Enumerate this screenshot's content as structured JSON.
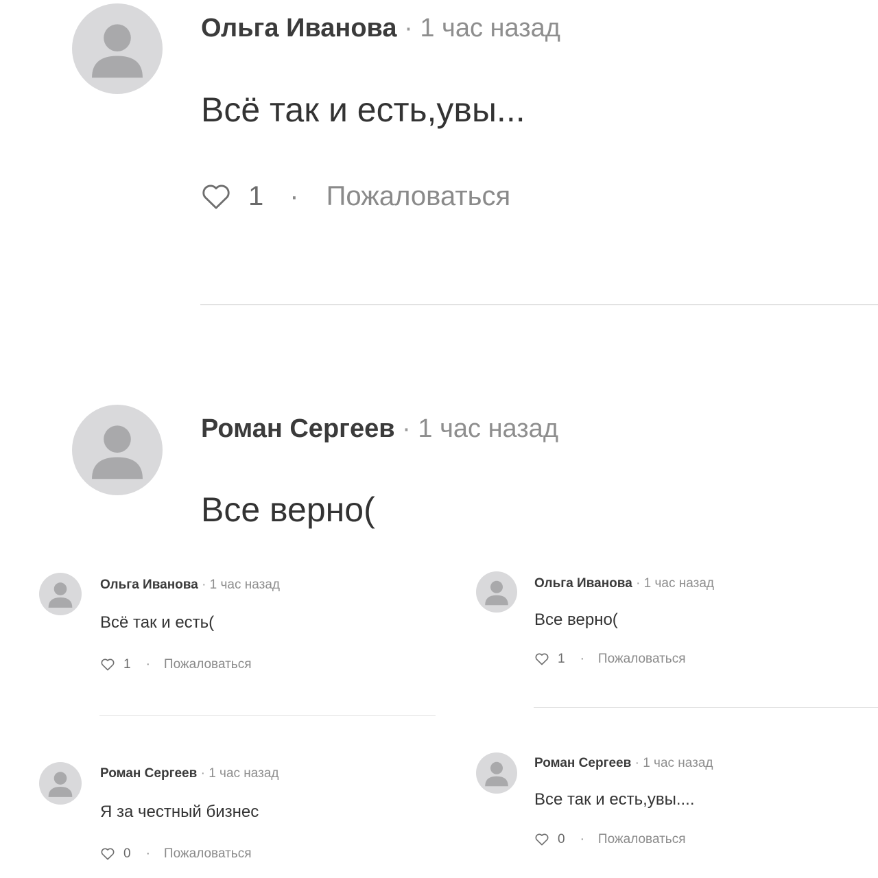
{
  "comments_large": [
    {
      "author": "Ольга Иванова",
      "separator": "·",
      "time": "1 час назад",
      "text": "Всё так и есть,увы...",
      "likes": "1",
      "report": "Пожаловаться"
    },
    {
      "author": "Роман Сергеев",
      "separator": "·",
      "time": "1 час назад",
      "text": "Все верно("
    }
  ],
  "comments_left": [
    {
      "author": "Ольга Иванова",
      "separator": "·",
      "time": "1 час назад",
      "text": "Всё так и есть(",
      "likes": "1",
      "report": "Пожаловаться"
    },
    {
      "author": "Роман Сергеев",
      "separator": "·",
      "time": "1 час назад",
      "text": "Я за честный бизнес",
      "likes": "0",
      "report": "Пожаловаться"
    }
  ],
  "comments_right": [
    {
      "author": "Ольга Иванова",
      "separator": "·",
      "time": "1 час назад",
      "text": "Все верно(",
      "likes": "1",
      "report": "Пожаловаться"
    },
    {
      "author": "Роман Сергеев",
      "separator": "·",
      "time": "1 час назад",
      "text": "Все так и есть,увы....",
      "likes": "0",
      "report": "Пожаловаться"
    }
  ],
  "action_dot": "·",
  "icons": {
    "avatar": "default-user-avatar-icon",
    "like": "heart-outline-icon"
  },
  "colors": {
    "avatar_bg": "#d9d9db",
    "avatar_figure": "#a9a9ab",
    "divider": "#e2e2e2"
  }
}
